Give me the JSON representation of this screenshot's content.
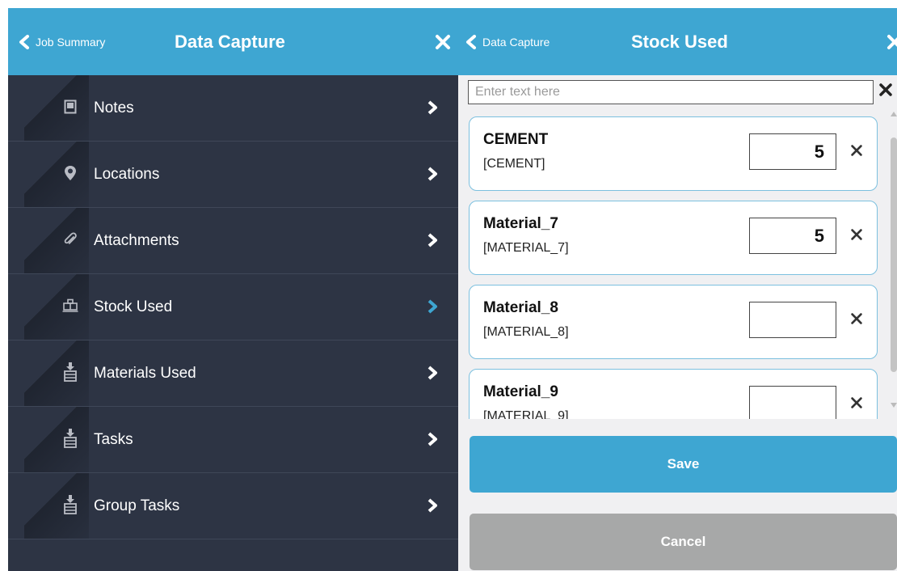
{
  "left": {
    "back_label": "Job Summary",
    "title": "Data Capture",
    "menu": [
      {
        "label": "Notes",
        "icon": "note-icon",
        "active": false
      },
      {
        "label": "Locations",
        "icon": "location-pin-icon",
        "active": false
      },
      {
        "label": "Attachments",
        "icon": "paperclip-icon",
        "active": false
      },
      {
        "label": "Stock Used",
        "icon": "stock-icon",
        "active": true
      },
      {
        "label": "Materials Used",
        "icon": "materials-icon",
        "active": false
      },
      {
        "label": "Tasks",
        "icon": "tasks-icon",
        "active": false
      },
      {
        "label": "Group Tasks",
        "icon": "group-tasks-icon",
        "active": false
      }
    ]
  },
  "right": {
    "back_label": "Data Capture",
    "title": "Stock Used",
    "search": {
      "placeholder": "Enter text here",
      "value": ""
    },
    "items": [
      {
        "name": "CEMENT",
        "code": "[CEMENT]",
        "qty": "5"
      },
      {
        "name": "Material_7",
        "code": "[MATERIAL_7]",
        "qty": "5"
      },
      {
        "name": "Material_8",
        "code": "[MATERIAL_8]",
        "qty": ""
      },
      {
        "name": "Material_9",
        "code": "[MATERIAL_9]",
        "qty": ""
      }
    ],
    "save_label": "Save",
    "cancel_label": "Cancel"
  },
  "colors": {
    "header": "#3ea6d2",
    "sidebar_bg": "#2d3444",
    "active_chevron": "#3ea6d2",
    "card_border": "#7cc0df",
    "cancel_bg": "#a7a8a8"
  }
}
